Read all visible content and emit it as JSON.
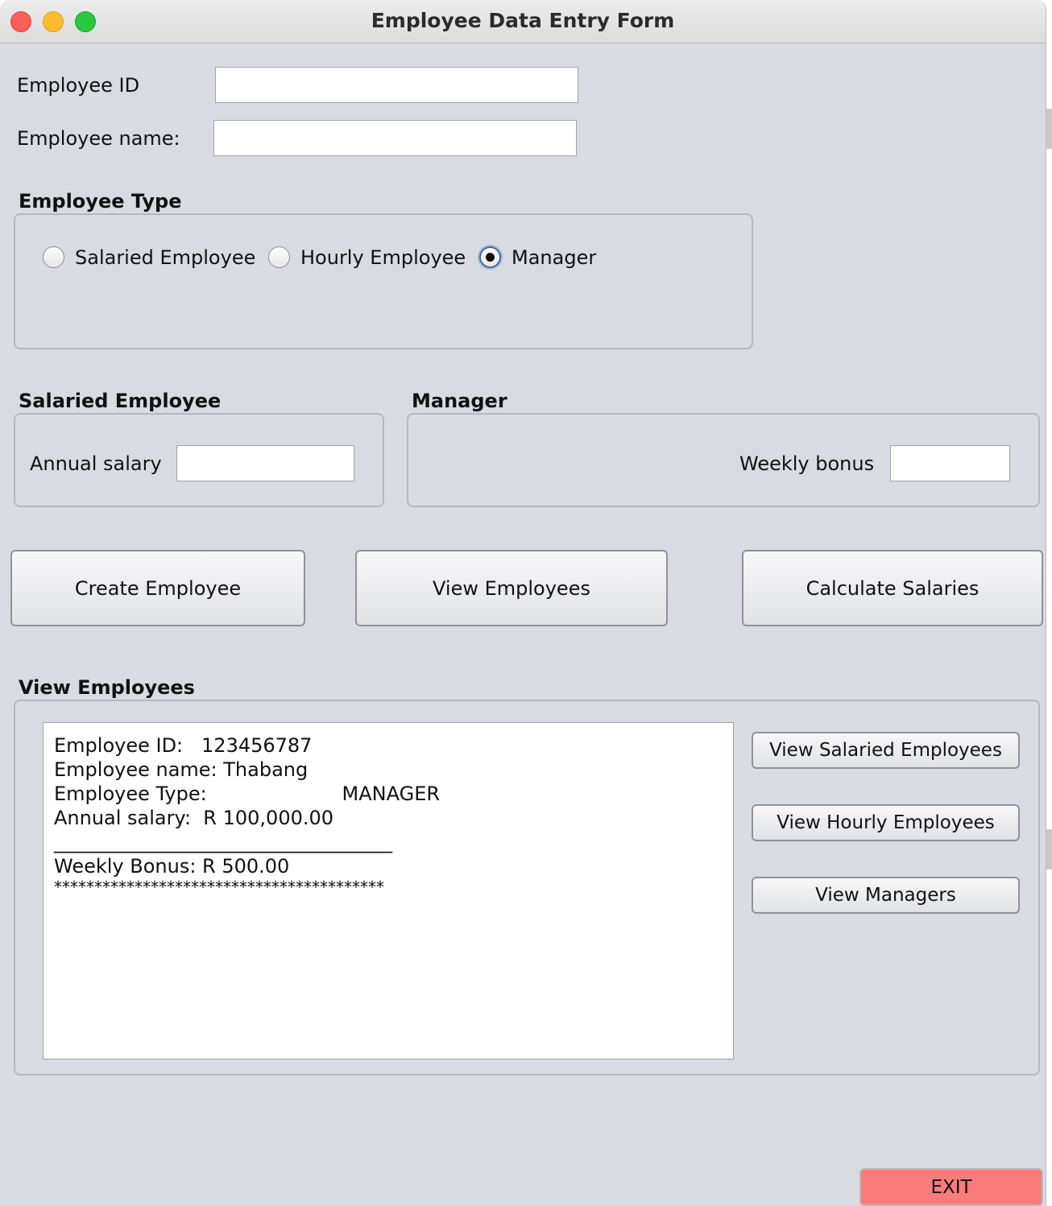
{
  "window": {
    "title": "Employee Data Entry Form"
  },
  "form": {
    "employee_id": {
      "label": "Employee ID",
      "value": ""
    },
    "employee_name": {
      "label": "Employee name:",
      "value": ""
    }
  },
  "employee_type": {
    "heading": "Employee Type",
    "options": [
      "Salaried Employee",
      "Hourly Employee",
      "Manager"
    ],
    "selected": "Manager"
  },
  "salaried": {
    "heading": "Salaried Employee",
    "annual_salary_label": "Annual salary",
    "annual_salary_value": ""
  },
  "manager": {
    "heading": "Manager",
    "weekly_bonus_label": "Weekly bonus",
    "weekly_bonus_value": ""
  },
  "actions": {
    "create": "Create Employee",
    "view": "View Employees",
    "calculate": "Calculate Salaries"
  },
  "view_panel": {
    "heading": "View Employees",
    "output": {
      "line1": "Employee ID:   123456787",
      "line2": "Employee name: Thabang",
      "line3": "Employee Type:                      MANAGER",
      "line4": "Annual salary:  R 100,000.00",
      "line5": "___________________________________",
      "line6": "Weekly Bonus: R 500.00",
      "line7": "*****************************************"
    },
    "buttons": {
      "salaried": "View Salaried Employees",
      "hourly": "View Hourly Employees",
      "managers": "View Managers"
    }
  },
  "exit_label": "EXIT"
}
